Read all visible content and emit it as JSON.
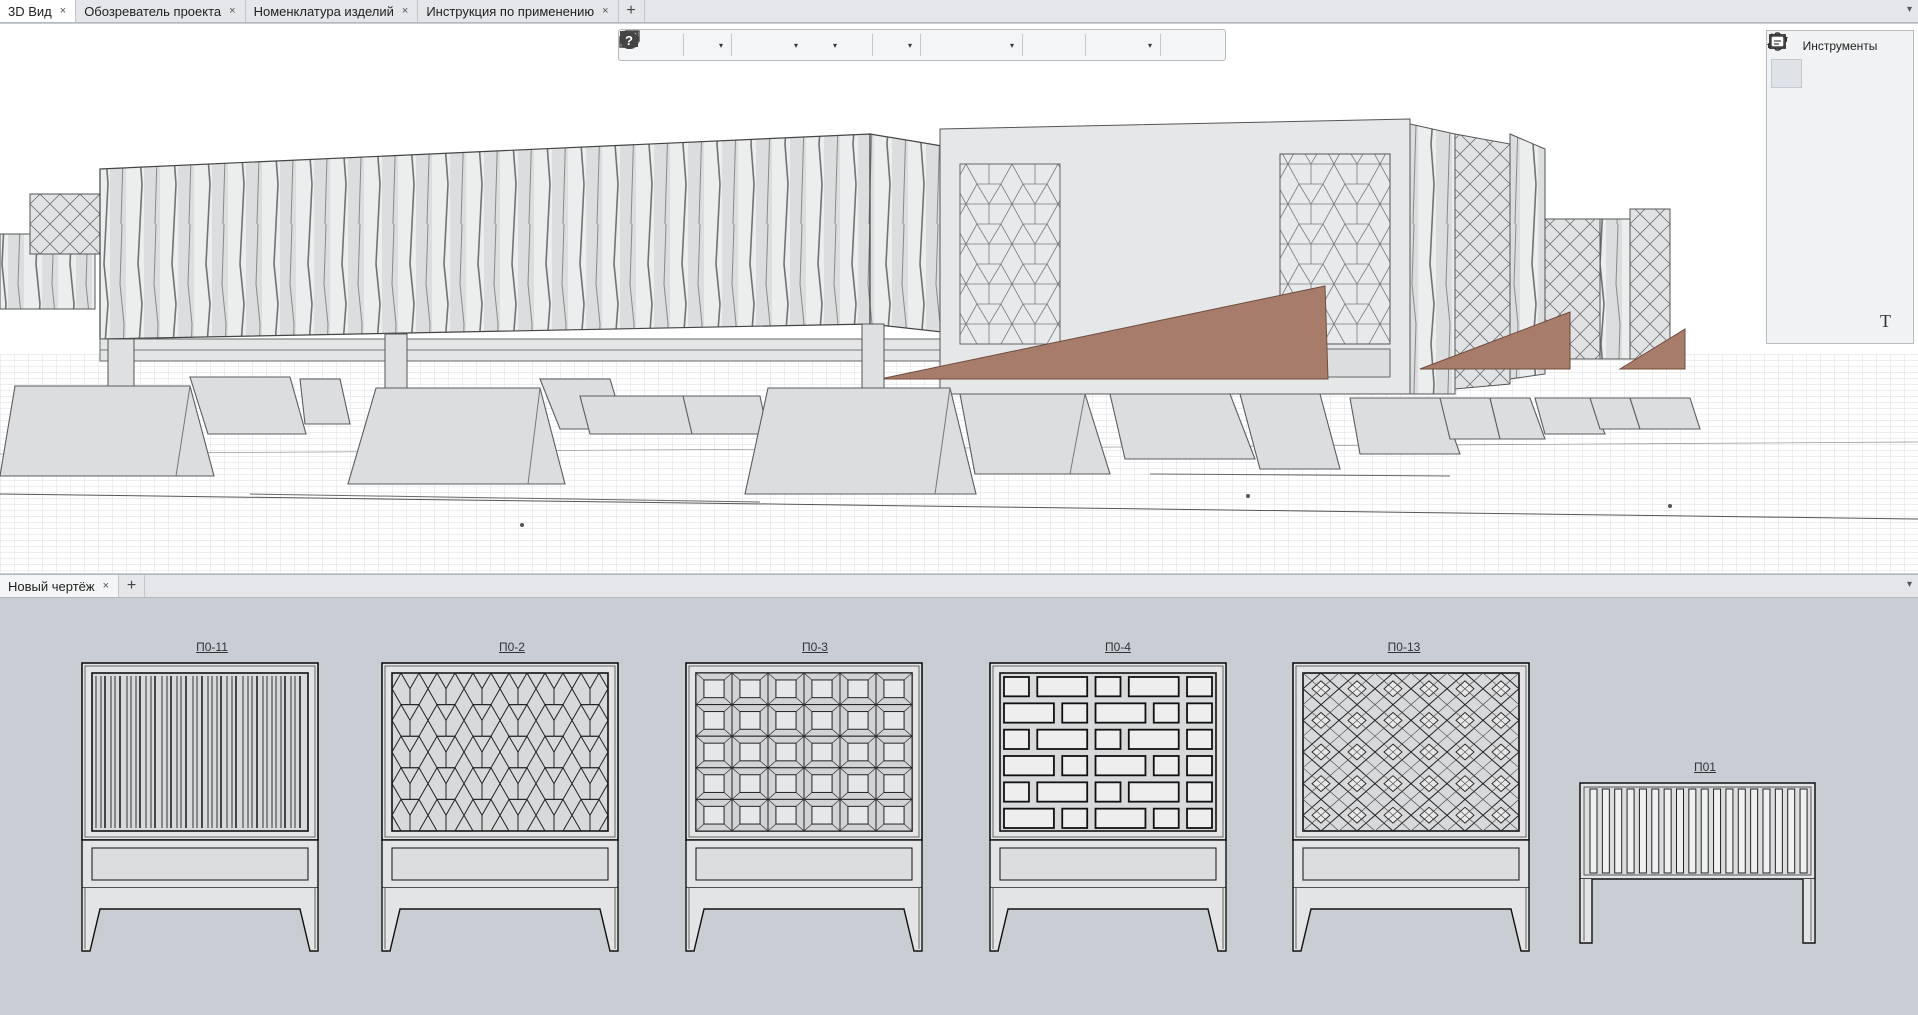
{
  "tabs": [
    {
      "label": "3D Вид",
      "active": true
    },
    {
      "label": "Обозреватель проекта",
      "active": false
    },
    {
      "label": "Номенклатура изделий",
      "active": false
    },
    {
      "label": "Инструкция по применению",
      "active": false
    }
  ],
  "tab_close_glyph": "×",
  "tab_add_glyph": "+",
  "tab_menu_glyph": "▾",
  "toolbar": {
    "icons": [
      "undo-icon",
      "redo-icon",
      "view-cube-icon",
      "open-folder-icon",
      "save-icon",
      "export-icon",
      "print-icon",
      "render-icon",
      "cut-icon",
      "copy-icon",
      "paste-icon",
      "text-style-icon",
      "properties-icon",
      "layers-icon",
      "views-icon",
      "settings-wrench-icon",
      "help-icon"
    ],
    "dropdown_glyph": "▾"
  },
  "tools_panel": {
    "title": "Инструменты",
    "tools": [
      "select-arrow-icon",
      "shape-tools-icon",
      "rectangle-icon",
      "column-icon",
      "slab-icon",
      "slab-hatched-icon",
      "roof-icon",
      "beam-icon",
      "stair-icon",
      "ramp-icon",
      "door-icon",
      "window-icon",
      "railing-icon",
      "line-icon",
      "furniture-icon",
      "pipe-icon",
      "fixture-icon",
      "equipment-icon",
      "fan-icon",
      "fitting-icon",
      "valve-icon",
      "boiler-icon",
      "pump-icon",
      "duct-icon",
      "sprinkler-icon",
      "lamp-icon",
      "cable-icon",
      "camera-icon",
      "panel-icon",
      "mesh-icon",
      "outlet-icon",
      "switch-icon",
      "dimension-icon",
      "curve-icon",
      "hatch-icon",
      "text-tool-icon"
    ],
    "text_tool_glyph": "T"
  },
  "drawing_tab": {
    "label": "Новый чертёж"
  },
  "panels": [
    {
      "label": "П0-11",
      "pattern": "vertical-slats"
    },
    {
      "label": "П0-2",
      "pattern": "hexagon"
    },
    {
      "label": "П0-3",
      "pattern": "square-grid"
    },
    {
      "label": "П0-4",
      "pattern": "brick"
    },
    {
      "label": "П0-13",
      "pattern": "diamond"
    },
    {
      "label": "П01",
      "pattern": "fence"
    }
  ],
  "colors": {
    "ramp": "#a87c6a",
    "panel_fill": "#e3e4e5",
    "background": "#c9ced4",
    "grid": "#d5d7da"
  }
}
